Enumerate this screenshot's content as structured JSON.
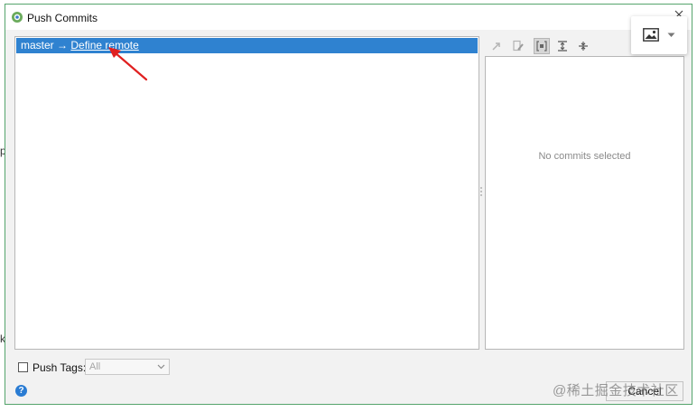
{
  "window": {
    "title": "Push Commits"
  },
  "branch": {
    "name": "master",
    "arrow": "→",
    "link": "Define remote"
  },
  "details": {
    "empty_text": "No commits selected"
  },
  "footer": {
    "push_tags_label": "Push Tags:",
    "push_tags_value": "All",
    "cancel_label": "Cancel",
    "help_glyph": "?"
  },
  "background": {
    "edge_glyph_1": "p",
    "edge_glyph_2": "k"
  },
  "watermark": {
    "text": "@稀土掘金技术社区"
  },
  "toolbar": {
    "icons": [
      "cherry-pick-icon",
      "edit-source-icon",
      "group-by-icon",
      "expand-all-icon",
      "collapse-all-icon"
    ]
  },
  "colors": {
    "selection": "#2f82d0",
    "dialog_border": "#55a46c",
    "annotation_arrow": "#e02020",
    "help": "#2a7cd3"
  }
}
